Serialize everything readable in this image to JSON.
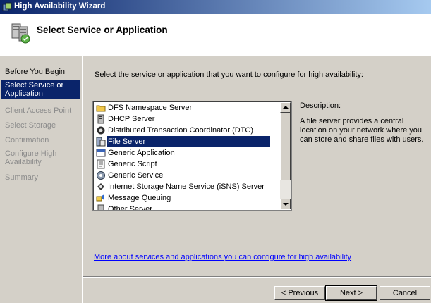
{
  "window": {
    "title": "High Availability Wizard"
  },
  "header": {
    "title": "Select Service or Application"
  },
  "sidebar": {
    "steps": [
      {
        "label": "Before You Begin",
        "state": "normal"
      },
      {
        "label": "Select Service or Application",
        "state": "active"
      },
      {
        "label": "Client Access Point",
        "state": "disabled"
      },
      {
        "label": "Select Storage",
        "state": "disabled"
      },
      {
        "label": "Confirmation",
        "state": "disabled"
      },
      {
        "label": "Configure High Availability",
        "state": "disabled"
      },
      {
        "label": "Summary",
        "state": "disabled"
      }
    ]
  },
  "main": {
    "instruction": "Select the service or application that you want to configure for high availability:",
    "list": {
      "items": [
        {
          "label": "DFS Namespace Server",
          "icon": "folder-tree-icon"
        },
        {
          "label": "DHCP Server",
          "icon": "server-icon"
        },
        {
          "label": "Distributed Transaction Coordinator (DTC)",
          "icon": "dtc-icon"
        },
        {
          "label": "File Server",
          "icon": "file-server-icon",
          "selected": true
        },
        {
          "label": "Generic Application",
          "icon": "application-icon"
        },
        {
          "label": "Generic Script",
          "icon": "script-icon"
        },
        {
          "label": "Generic Service",
          "icon": "service-gear-icon"
        },
        {
          "label": "Internet Storage Name Service (iSNS) Server",
          "icon": "isns-icon"
        },
        {
          "label": "Message Queuing",
          "icon": "message-queue-icon"
        },
        {
          "label": "Other Server",
          "icon": "server-icon"
        }
      ]
    },
    "description": {
      "label": "Description:",
      "text": "A file server provides a central location on your network where you can store and share files with users."
    },
    "more_link": "More about services and applications you can configure for high availability"
  },
  "buttons": {
    "previous": "< Previous",
    "next": "Next >",
    "cancel": "Cancel"
  },
  "colors": {
    "selection": "#0a246a",
    "link": "#0000ff",
    "disabled_text": "#8c8c8c"
  }
}
